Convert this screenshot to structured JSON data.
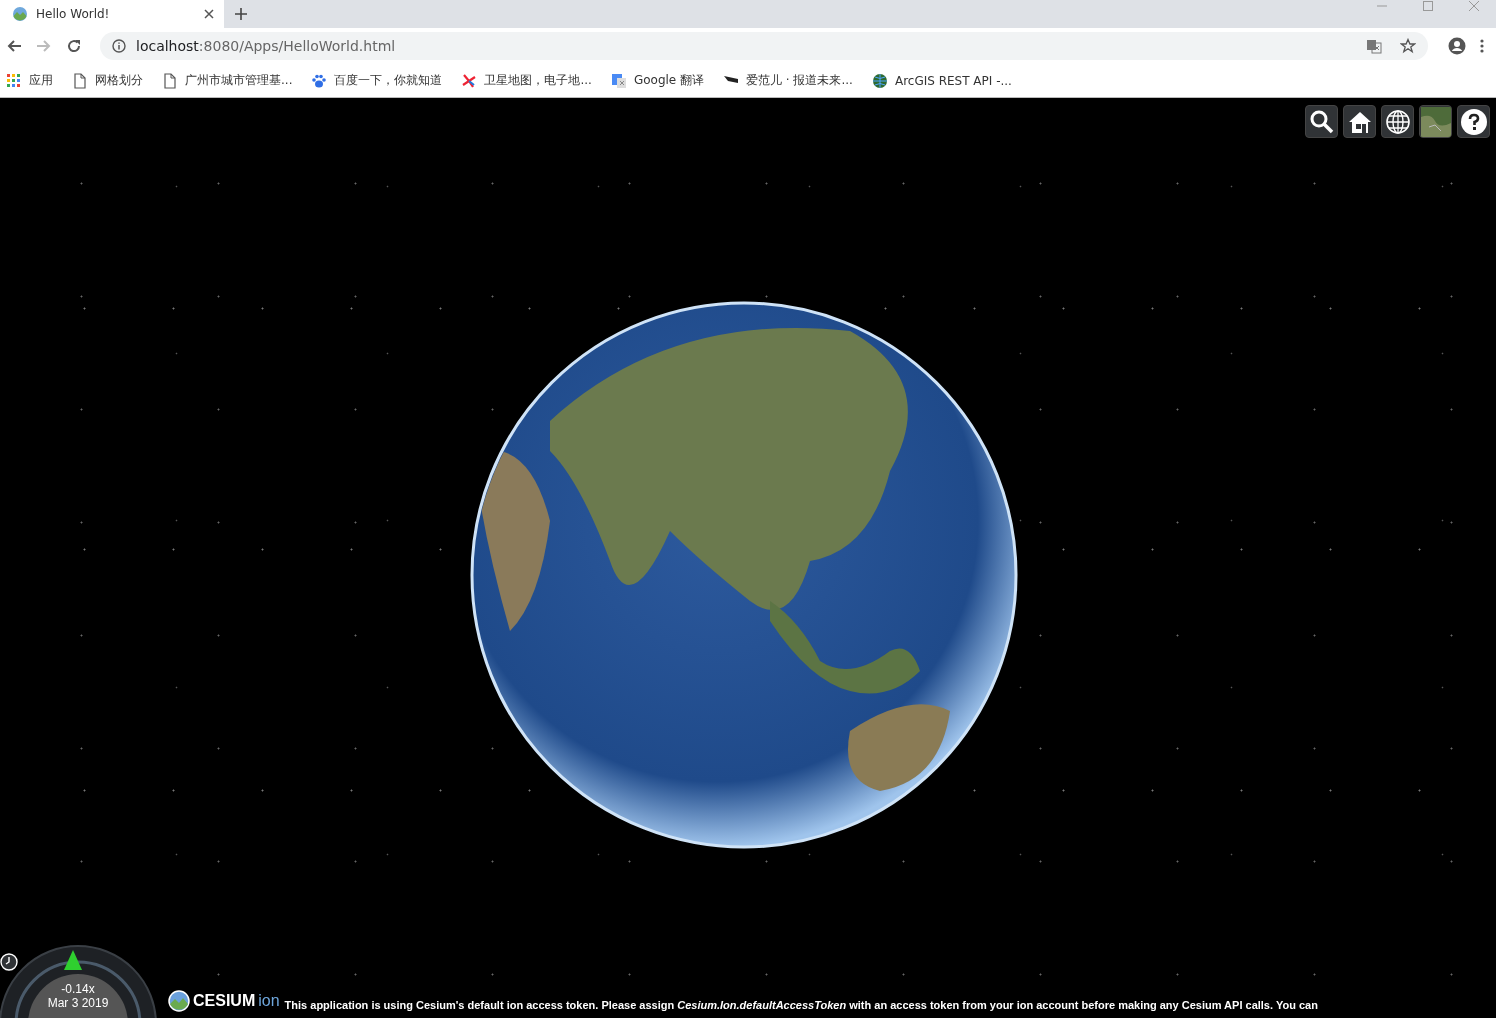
{
  "browser": {
    "tabs": [
      {
        "title": "Hello World!",
        "selected": true
      }
    ],
    "address": {
      "host": "localhost",
      "path": ":8080/Apps/HelloWorld.html"
    },
    "bookmarks": [
      {
        "label": "应用"
      },
      {
        "label": "网格划分"
      },
      {
        "label": "广州市城市管理基..."
      },
      {
        "label": "百度一下，你就知道"
      },
      {
        "label": "卫星地图，电子地..."
      },
      {
        "label": "Google 翻译"
      },
      {
        "label": "爱范儿 · 报道未来..."
      },
      {
        "label": "ArcGIS REST API -..."
      }
    ]
  },
  "viewer": {
    "animation": {
      "speed": "-0.14x",
      "date": "Mar 3 2019"
    },
    "credit": {
      "logo": "CESIUM",
      "logo_suffix": "ion",
      "notice": "This application is using Cesium's default ion access token. Please assign *Cesium.Ion.defaultAccessToken* with an access token from your ion account before making any Cesium API calls. You can"
    }
  }
}
